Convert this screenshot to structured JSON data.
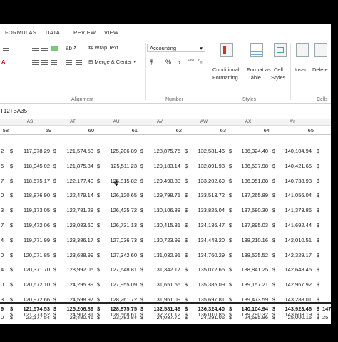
{
  "ribbon": {
    "tabs": [
      "FORMULAS",
      "DATA",
      "REVIEW",
      "VIEW"
    ],
    "wrap_text": "Wrap Text",
    "merge_center": "Merge & Center",
    "number_format": "Accounting",
    "number_symbols": [
      "$",
      "%",
      "›"
    ],
    "conditional_formatting": [
      "Conditional",
      "Formatting"
    ],
    "format_as_table": [
      "Format as",
      "Table"
    ],
    "cell_styles": [
      "Cell",
      "Styles"
    ],
    "insert": "Insert",
    "delete": "Delete",
    "group_labels": [
      "Alignment",
      "Number",
      "Styles",
      "Cells"
    ]
  },
  "formula_bar": {
    "text": "T12+BA35"
  },
  "columns": [
    "AS",
    "AT",
    "AU",
    "AV",
    "AW",
    "AX",
    "AY"
  ],
  "header_numbers": [
    "58",
    "59",
    "60",
    "61",
    "62",
    "63",
    "64",
    "65"
  ],
  "row_labels": [
    "2",
    "5",
    "7",
    "0",
    "3",
    "7",
    "4",
    "0",
    "4",
    "0",
    "3"
  ],
  "rows": [
    [
      "117,978.29",
      "121,574.53",
      "125,206.89",
      "128,875.75",
      "132,581.46",
      "136,324.40",
      "140,104.94"
    ],
    [
      "118,045.02",
      "121,875.84",
      "125,511.23",
      "129,183.14",
      "132,891.93",
      "136,637.98",
      "140,421.65"
    ],
    [
      "118,575.17",
      "122,177.40",
      "125,815.82",
      "129,490.80",
      "133,202.69",
      "136,951.88",
      "140,738.93"
    ],
    [
      "118,876.90",
      "122,479.14",
      "126,120.65",
      "129,798.71",
      "133,513.72",
      "137,265.89",
      "141,056.04"
    ],
    [
      "119,173.05",
      "122,781.28",
      "126,425.72",
      "130,106.88",
      "133,825.04",
      "137,580.30",
      "141,373.86"
    ],
    [
      "119,472.06",
      "123,083.60",
      "126,731.13",
      "130,415.31",
      "134,136.47",
      "137,895.03",
      "141,692.44"
    ],
    [
      "119,771.99",
      "123,386.17",
      "127,036.73",
      "130,723.99",
      "134,448.20",
      "138,210.16",
      "142,010.51"
    ],
    [
      "120,071.85",
      "123,688.99",
      "127,342.60",
      "131,032.91",
      "134,760.29",
      "138,525.52",
      "142,329.17"
    ],
    [
      "120,371.70",
      "123,992.05",
      "127,648.81",
      "131,342.17",
      "135,072.66",
      "138,841.25",
      "142,648.45"
    ],
    [
      "120,672.10",
      "124,295.39",
      "127,955.09",
      "131,651.55",
      "135,385.09",
      "139,157.21",
      "142,967.92"
    ],
    [
      "120,972.66",
      "124,598.97",
      "128,261.72",
      "131,961.09",
      "135,697.81",
      "139,473.59",
      "143,288.01"
    ],
    [
      "121,273.52",
      "124,902.81",
      "128,568.61",
      "132,271.12",
      "136,010.85",
      "139,790.32",
      "143,608.19"
    ]
  ],
  "totals": {
    "label": "9",
    "values": [
      "121,574.53",
      "125,206.89",
      "128,875.75",
      "132,581.46",
      "136,324.40",
      "140,104.94",
      "143,923.46",
      "147,"
    ]
  },
  "bottom_row": {
    "label": "0",
    "values": [
      "23,177.54",
      "23,480.46",
      "23,783.84",
      "24,087.70",
      "24,391.06",
      "24,695.86",
      "25,000.16",
      "25,"
    ]
  },
  "currency_symbol": "$"
}
